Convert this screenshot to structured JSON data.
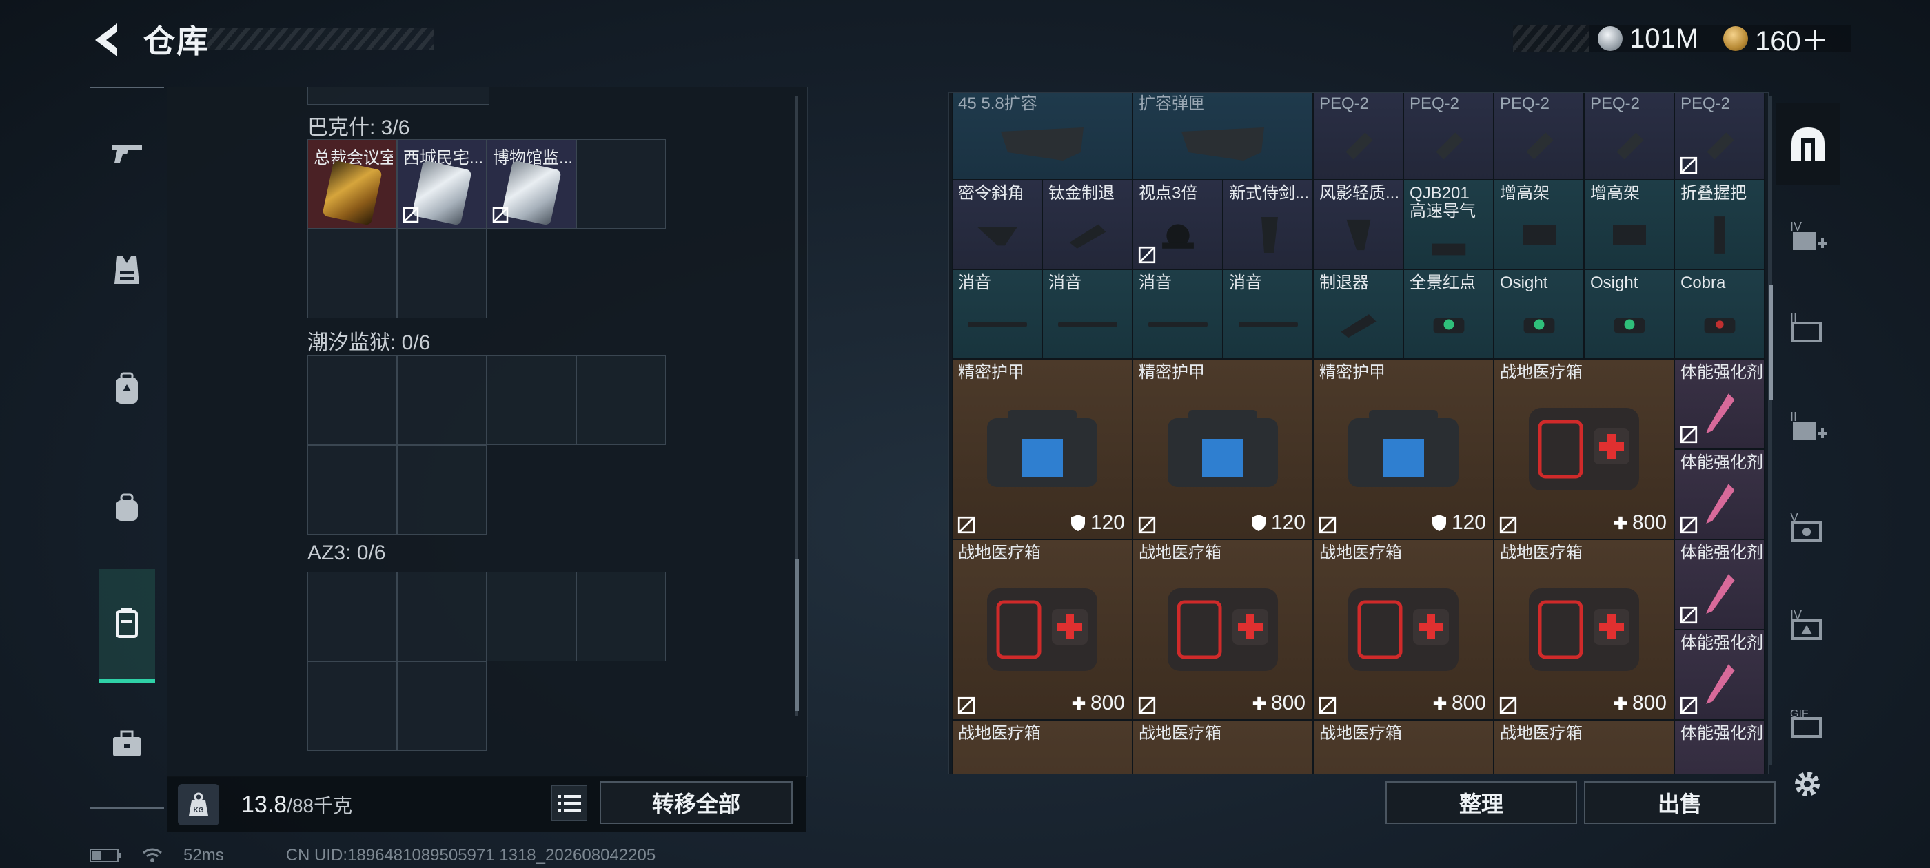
{
  "header": {
    "title": "仓库",
    "currency": [
      {
        "icon": "silver-coin-icon",
        "value": "101M"
      },
      {
        "icon": "gold-coin-icon",
        "value": "160＋"
      }
    ]
  },
  "left_nav": [
    "pistol-icon",
    "vest-icon",
    "backpack-icon",
    "bag-icon",
    "case-icon",
    "briefcase-icon"
  ],
  "storage": {
    "groups": [
      {
        "label": "巴克什: 3/6",
        "items": [
          "总裁会议室",
          "西城民宅...",
          "博物馆监..."
        ]
      },
      {
        "label": "潮汐监狱: 0/6"
      },
      {
        "label": "AZ3: 0/6"
      }
    ],
    "weight": {
      "current": "13.8",
      "capacity": "/88千克"
    },
    "transfer_all": "转移全部"
  },
  "inventory": {
    "row1": [
      "45 5.8扩容",
      "扩容弹匣",
      "PEQ-2",
      "PEQ-2",
      "PEQ-2",
      "PEQ-2",
      "PEQ-2"
    ],
    "row2": [
      "密令斜角",
      "钛金制退",
      "视点3倍",
      "新式侍剑...",
      "风影轻质...",
      "QJB201\n高速导气",
      "增高架",
      "增高架",
      "折叠握把"
    ],
    "row3": [
      "消音",
      "消音",
      "消音",
      "消音",
      "制退器",
      "全景红点",
      "Osight",
      "Osight",
      "Cobra"
    ],
    "row4": [
      "精密护甲",
      "精密护甲",
      "精密护甲",
      "战地医疗箱"
    ],
    "row4_values": [
      "120",
      "120",
      "120",
      "800"
    ],
    "row5": [
      "战地医疗箱",
      "战地医疗箱",
      "战地医疗箱",
      "战地医疗箱"
    ],
    "row5_values": [
      "800",
      "800",
      "800",
      "800"
    ],
    "row6": [
      "战地医疗箱",
      "战地医疗箱",
      "战地医疗箱",
      "战地医疗箱"
    ],
    "side": [
      "体能强化剂",
      "体能强化剂",
      "体能强化剂",
      "体能强化剂",
      "体能强化剂"
    ],
    "sort": "整理",
    "sell": "出售"
  },
  "right_nav": [
    "home-icon",
    "level4-plus-icon",
    "level2-icon",
    "level2-plus-icon",
    "level5-icon",
    "level4-icon",
    "gift-icon"
  ],
  "status": {
    "ping": "52ms",
    "uid": "CN UID:1896481089505971 1318_202608042205"
  },
  "colors": {
    "accent": "#2fd1a7"
  }
}
